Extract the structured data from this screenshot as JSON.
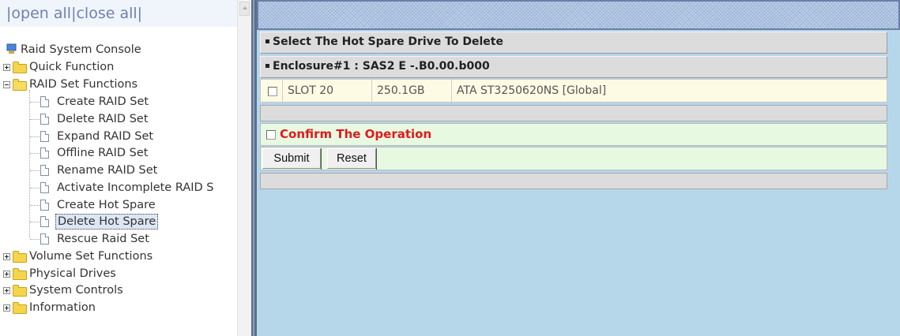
{
  "left_frame": {
    "top_links": {
      "open_all": "open all",
      "close_all": "close all",
      "separator": "|"
    },
    "tree": {
      "root_label": "Raid System Console",
      "quick_function": "Quick Function",
      "raid_set_functions": {
        "label": "RAID Set Functions",
        "items": [
          "Create RAID Set",
          "Delete RAID Set",
          "Expand RAID Set",
          "Offline RAID Set",
          "Rename RAID Set",
          "Activate Incomplete RAID S",
          "Create Hot Spare",
          "Delete Hot Spare",
          "Rescue Raid Set"
        ],
        "selected_item": "Delete Hot Spare"
      },
      "volume_set_functions": "Volume Set Functions",
      "physical_drives": "Physical Drives",
      "system_controls": "System Controls",
      "information": "Information"
    }
  },
  "main": {
    "section_title": "Select The Hot Spare Drive To Delete",
    "enclosure_title": "Enclosure#1 : SAS2 E -.B0.00.b000",
    "drive_row": {
      "slot": "SLOT 20",
      "capacity": "250.1GB",
      "model": "ATA ST3250620NS [Global]",
      "checked": false
    },
    "confirm": {
      "label": "Confirm The Operation",
      "checked": false
    },
    "buttons": {
      "submit": "Submit",
      "reset": "Reset"
    }
  },
  "colors": {
    "right_background": "#b6d6ea",
    "confirm_text": "#e01a1a",
    "row_highlight": "#fdfbe4",
    "confirm_background": "#e8f9e2"
  }
}
